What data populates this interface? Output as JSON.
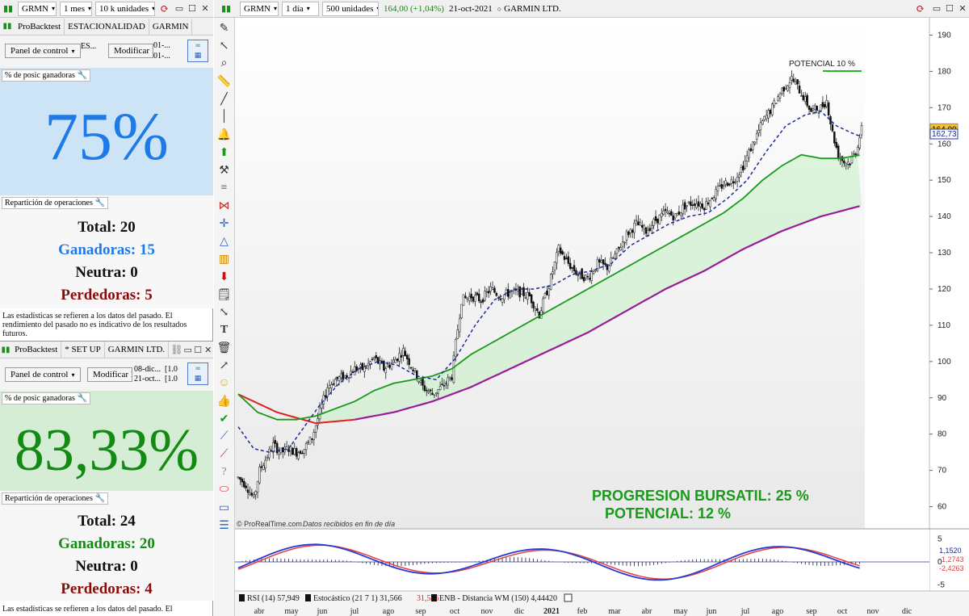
{
  "left_top_toolbar": {
    "symbol": "GRMN",
    "period": "1 mes",
    "units": "10 k unidades"
  },
  "top_panel": {
    "tabs": [
      "ProBacktest",
      "ESTACIONALIDAD",
      "GARMIN"
    ],
    "panel_button": "Panel de control",
    "modify_button": "Modificar P",
    "small_code": "ES...",
    "dates": [
      "01-...",
      "01-..."
    ],
    "metric_label": "% de posic ganadoras",
    "big_value": "75%",
    "rep_label": "Repartición de operaciones",
    "total": "Total: 20",
    "winners": "Ganadoras: 15",
    "neutral": "Neutra: 0",
    "losers": "Perdedoras: 5",
    "note": "Las estadísticas se refieren a los datos del pasado. El rendimiento del pasado no es indicativo de los resultados futuros."
  },
  "bottom_panel": {
    "tabs": [
      "ProBacktest",
      "* SET UP",
      "GARMIN LTD."
    ],
    "panel_button": "Panel de control",
    "modify_button": "Modificar P",
    "dates": [
      "08-dic...",
      "21-oct..."
    ],
    "vals": [
      "[1.0",
      "[1.0"
    ],
    "metric_label": "% de posic ganadoras",
    "big_value": "83,33%",
    "rep_label": "Repartición de operaciones",
    "total": "Total: 24",
    "winners": "Ganadoras: 20",
    "neutral": "Neutra: 0",
    "losers": "Perdedoras: 4",
    "note": "Las estadísticas se refieren a los datos del pasado. El"
  },
  "chart_toolbar": {
    "symbol": "GRMN",
    "period": "1 día",
    "units": "500 unidades",
    "quote": "164,00 (+1,04%)",
    "date": "21-oct-2021",
    "name": "GARMIN LTD."
  },
  "colors": {
    "blue": "#1e7ae6",
    "green": "#138a13",
    "red": "#8b0a0a",
    "blue_bg": "#cde4f7",
    "green_bg": "#d4edd4"
  },
  "chart_data": {
    "type": "line",
    "y_ticks": [
      "190",
      "180",
      "170",
      "160",
      "150",
      "140",
      "130",
      "120",
      "110",
      "100",
      "90",
      "80",
      "70",
      "60"
    ],
    "ylim": [
      55,
      193
    ],
    "x_labels": [
      "abr",
      "may",
      "jun",
      "jul",
      "ago",
      "sep",
      "oct",
      "nov",
      "dic",
      "2021",
      "feb",
      "mar",
      "abr",
      "may",
      "jun",
      "jul",
      "ago",
      "sep",
      "oct",
      "nov",
      "dic"
    ],
    "price_label": "164,00",
    "ma_label": "162,73",
    "annotation_top": "POTENCIAL 10 %",
    "text1": "PROGRESION BURSATIL: 25 %",
    "text2": "POTENCIAL: 12 %",
    "watermark": "© ProRealTime.com",
    "watermark2": "Datos recibidos en fin de día",
    "price": [
      [
        0,
        68
      ],
      [
        4,
        66
      ],
      [
        8,
        62
      ],
      [
        11,
        70
      ],
      [
        14,
        73
      ],
      [
        18,
        77
      ],
      [
        22,
        75
      ],
      [
        26,
        76
      ],
      [
        30,
        75
      ],
      [
        34,
        76
      ],
      [
        38,
        79
      ],
      [
        42,
        86
      ],
      [
        46,
        93
      ],
      [
        50,
        95
      ],
      [
        55,
        96
      ],
      [
        60,
        98
      ],
      [
        65,
        98
      ],
      [
        70,
        101
      ],
      [
        75,
        98
      ],
      [
        80,
        100
      ],
      [
        85,
        103
      ],
      [
        90,
        98
      ],
      [
        95,
        93
      ],
      [
        100,
        91
      ],
      [
        105,
        93
      ],
      [
        110,
        96
      ],
      [
        112,
        105
      ],
      [
        115,
        117
      ],
      [
        120,
        118
      ],
      [
        125,
        117
      ],
      [
        130,
        120
      ],
      [
        135,
        118
      ],
      [
        140,
        119
      ],
      [
        145,
        119
      ],
      [
        150,
        118
      ],
      [
        155,
        113
      ],
      [
        160,
        121
      ],
      [
        165,
        131
      ],
      [
        170,
        127
      ],
      [
        175,
        124
      ],
      [
        180,
        123
      ],
      [
        185,
        127
      ],
      [
        190,
        126
      ],
      [
        195,
        130
      ],
      [
        200,
        135
      ],
      [
        205,
        138
      ],
      [
        210,
        136
      ],
      [
        215,
        139
      ],
      [
        220,
        141
      ],
      [
        225,
        140
      ],
      [
        230,
        143
      ],
      [
        235,
        144
      ],
      [
        240,
        143
      ],
      [
        245,
        146
      ],
      [
        250,
        149
      ],
      [
        255,
        150
      ],
      [
        260,
        154
      ],
      [
        265,
        160
      ],
      [
        270,
        166
      ],
      [
        275,
        170
      ],
      [
        280,
        175
      ],
      [
        285,
        178
      ],
      [
        290,
        174
      ],
      [
        295,
        169
      ],
      [
        300,
        170
      ],
      [
        303,
        172
      ],
      [
        306,
        163
      ],
      [
        309,
        157
      ],
      [
        312,
        155
      ],
      [
        315,
        155
      ],
      [
        318,
        158
      ],
      [
        321,
        164
      ]
    ],
    "ma_short": [
      [
        0,
        82
      ],
      [
        8,
        76
      ],
      [
        16,
        75
      ],
      [
        26,
        76
      ],
      [
        34,
        82
      ],
      [
        42,
        88
      ],
      [
        52,
        94
      ],
      [
        62,
        98
      ],
      [
        72,
        100
      ],
      [
        82,
        99
      ],
      [
        92,
        96
      ],
      [
        102,
        95
      ],
      [
        112,
        101
      ],
      [
        122,
        110
      ],
      [
        132,
        117
      ],
      [
        142,
        120
      ],
      [
        152,
        120
      ],
      [
        162,
        121
      ],
      [
        172,
        124
      ],
      [
        182,
        125
      ],
      [
        192,
        127
      ],
      [
        202,
        132
      ],
      [
        212,
        135
      ],
      [
        222,
        138
      ],
      [
        232,
        140
      ],
      [
        242,
        141
      ],
      [
        252,
        145
      ],
      [
        262,
        150
      ],
      [
        272,
        158
      ],
      [
        282,
        165
      ],
      [
        292,
        168
      ],
      [
        300,
        169
      ],
      [
        308,
        165
      ],
      [
        316,
        163
      ],
      [
        321,
        162
      ]
    ],
    "ma_mid": [
      [
        0,
        91
      ],
      [
        10,
        86
      ],
      [
        20,
        84
      ],
      [
        30,
        84
      ],
      [
        40,
        85
      ],
      [
        50,
        87
      ],
      [
        60,
        89
      ],
      [
        70,
        92
      ],
      [
        80,
        94
      ],
      [
        90,
        95
      ],
      [
        100,
        96
      ],
      [
        110,
        98
      ],
      [
        120,
        102
      ],
      [
        130,
        105
      ],
      [
        140,
        108
      ],
      [
        150,
        111
      ],
      [
        160,
        114
      ],
      [
        170,
        117
      ],
      [
        180,
        120
      ],
      [
        190,
        123
      ],
      [
        200,
        126
      ],
      [
        210,
        129
      ],
      [
        220,
        132
      ],
      [
        230,
        135
      ],
      [
        240,
        138
      ],
      [
        250,
        141
      ],
      [
        260,
        145
      ],
      [
        270,
        150
      ],
      [
        280,
        154
      ],
      [
        290,
        157
      ],
      [
        300,
        156
      ],
      [
        310,
        156
      ],
      [
        321,
        157
      ]
    ],
    "ma_long": [
      [
        0,
        91
      ],
      [
        20,
        86
      ],
      [
        40,
        83
      ],
      [
        60,
        84
      ],
      [
        80,
        86
      ],
      [
        100,
        89
      ],
      [
        120,
        93
      ],
      [
        140,
        98
      ],
      [
        160,
        103
      ],
      [
        180,
        108
      ],
      [
        200,
        114
      ],
      [
        220,
        120
      ],
      [
        240,
        125
      ],
      [
        260,
        131
      ],
      [
        280,
        136
      ],
      [
        300,
        140
      ],
      [
        321,
        143
      ]
    ],
    "osc_ticks": [
      "5",
      "0",
      "-5"
    ],
    "osc_labels": [
      "1,1520",
      "-1,2743",
      "-2,4263"
    ],
    "legend": [
      "RSI (14) 57,949",
      "Estocástico (21 7 1) 31,566",
      "31,566",
      "ENB - Distancia WM (150) 4,4442",
      "0"
    ]
  }
}
